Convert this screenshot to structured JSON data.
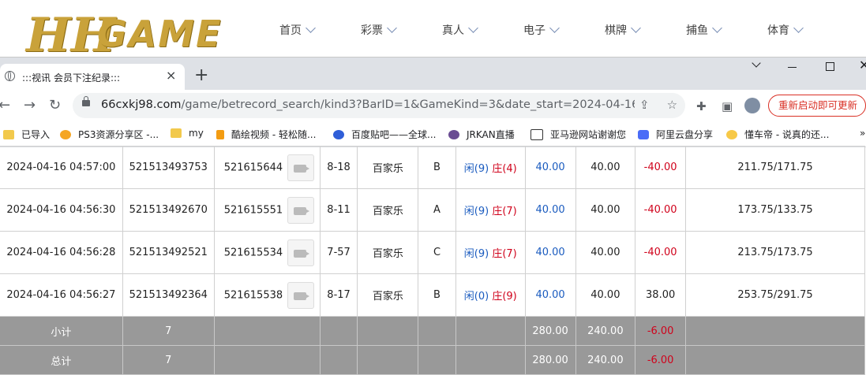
{
  "site": {
    "logo_hh": "HH",
    "logo_game": "GAME",
    "nav": [
      "首页",
      "彩票",
      "真人",
      "电子",
      "棋牌",
      "捕鱼",
      "体育"
    ]
  },
  "browser": {
    "tab_title": ":::视讯 会员下注纪录:::",
    "tab_close": "×",
    "new_tab": "+",
    "url_host": "66cxkj98.com",
    "url_path": "/game/betrecord_search/kind3?BarID=1&GameKind=3&date_start=2024-04-16&dat...",
    "update_button": "重新启动即可更新",
    "bookmarks": [
      "已导入",
      "PS3资源分享区 -...",
      "my",
      "酷绘视频 - 轻松随...",
      "百度贴吧——全球...",
      "JRKAN直播",
      "亚马逊网站谢谢您",
      "阿里云盘分享",
      "懂车帝 - 说真的还..."
    ],
    "bookmarks_more": "»"
  },
  "table": {
    "rows": [
      {
        "time": "2024-04-16 04:57:00",
        "bet_no": "521513493753",
        "game_no": "521615644",
        "table_no": "8-18",
        "game": "百家乐",
        "seat": "B",
        "r1": "闲(9)",
        "r2": "庄(4)",
        "bet": "40.00",
        "valid": "40.00",
        "win": "-40.00",
        "balance": "211.75/171.75"
      },
      {
        "time": "2024-04-16 04:56:30",
        "bet_no": "521513492670",
        "game_no": "521615551",
        "table_no": "8-11",
        "game": "百家乐",
        "seat": "A",
        "r1": "闲(9)",
        "r2": "庄(7)",
        "bet": "40.00",
        "valid": "40.00",
        "win": "-40.00",
        "balance": "173.75/133.75"
      },
      {
        "time": "2024-04-16 04:56:28",
        "bet_no": "521513492521",
        "game_no": "521615534",
        "table_no": "7-57",
        "game": "百家乐",
        "seat": "C",
        "r1": "闲(9)",
        "r2": "庄(7)",
        "bet": "40.00",
        "valid": "40.00",
        "win": "-40.00",
        "balance": "213.75/173.75"
      },
      {
        "time": "2024-04-16 04:56:27",
        "bet_no": "521513492364",
        "game_no": "521615538",
        "table_no": "8-17",
        "game": "百家乐",
        "seat": "B",
        "r1": "闲(0)",
        "r2": "庄(9)",
        "bet": "40.00",
        "valid": "40.00",
        "win": "38.00",
        "balance": "253.75/291.75"
      }
    ],
    "subtotal": {
      "label": "小计",
      "count": "7",
      "bet": "280.00",
      "valid": "240.00",
      "win": "-6.00"
    },
    "total": {
      "label": "总计",
      "count": "7",
      "bet": "280.00",
      "valid": "240.00",
      "win": "-6.00"
    }
  }
}
